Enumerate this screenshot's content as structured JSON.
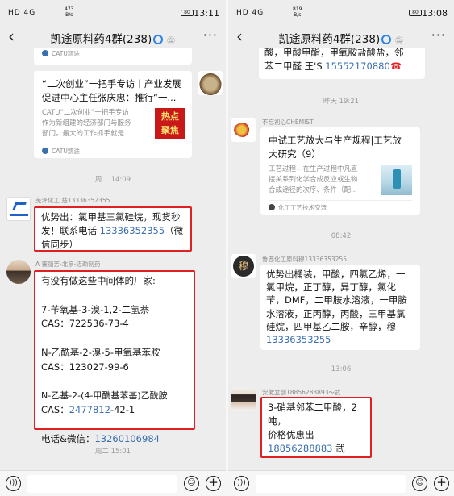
{
  "left": {
    "status": {
      "signal": "HD 4G",
      "speed": "473\nB/s",
      "battery": "80",
      "time": "13:11"
    },
    "header": {
      "title": "凯途原料药4群(238)"
    },
    "card_top_footer": "CATU凯途",
    "article_card": {
      "title_lines": [
        "“二次创业”一把手专访丨产业发展",
        "促进中心主任张庆忠：推行“一..."
      ],
      "desc_lines": [
        "CATU“二次创业”一把手专访",
        "作为新组建的经济部门与服务",
        "部门，最大的工作抓手就是..."
      ],
      "thumb_text": [
        "热点",
        "聚焦"
      ],
      "footer": "CATU凯途"
    },
    "ts1": "周二 14:09",
    "msg1": {
      "sender": "芜泽化工 楚13336352355",
      "lines": [
        "优势出：氯甲基三氯硅烷，现货秒",
        "发！联系电话 ",
        "信同步）"
      ],
      "phone": "13336352355",
      "after_phone": "（微"
    },
    "msg2": {
      "sender": "A 董丽芳-北京-迈劲制药",
      "lines": [
        "有没有做这些中间体的厂家:",
        "",
        "7-苄氧基-3-溴-1,2-二氢萘",
        "CAS：722536-73-4",
        "",
        "N-乙酰基-2-溴-5-甲氧基苯胺",
        "CAS：123027-99-6",
        "",
        "N-乙基-2-(4-甲酰基苯基)乙酰胺",
        "CAS："
      ],
      "cas_link": "2477812",
      "cas_rest": "-42-1",
      "contact_label": "电话&微信：",
      "contact_phone": "13260106984"
    },
    "ts2": "周二 15:01"
  },
  "right": {
    "status": {
      "signal": "HD 4G",
      "speed": "819\nB/s",
      "battery": "80",
      "time": "13:08"
    },
    "header": {
      "title": "凯途原料药4群(238)"
    },
    "top_bubble": {
      "lines": [
        "酸，甲酸甲酯，甲氧胺盐酸盐，邻",
        "苯二甲醛   王'S "
      ],
      "phone": "15552170880"
    },
    "ts1": "昨天 19:21",
    "card_msg": {
      "sender": "不忘初心CHEMIST",
      "title_lines": [
        "中试工艺放大与生产规程|工艺放",
        "大研究（9）"
      ],
      "desc_lines": [
        "工艺过程—在生产过程中凡直",
        "接关系到化学合成反应或生物",
        "合成途径的次序、条件（配..."
      ],
      "footer": "化工工艺技术交流"
    },
    "ts2": "08:42",
    "msg_lu": {
      "sender": "鲁西化工原料穆13336353255",
      "avatar_char": "穆",
      "lines": [
        "优势出桶装，甲酸，四氯乙烯，一",
        "氯甲烷，正丁醇，异丁醇，氯化",
        "苄，DMF，二甲胺水溶液，一甲胺",
        "水溶液，正丙醇，丙酸，三甲基氯",
        "硅烷，四甲基乙二胺，辛醇，穆"
      ],
      "phone": "13336353255"
    },
    "ts3": "13:06",
    "msg_wu": {
      "sender": "安徽立创18856288893～武",
      "lines": [
        "3-硝基邻苯二甲酸，2",
        "吨，",
        "价格优惠出"
      ],
      "phone": "18856288883",
      "suffix": " 武"
    }
  },
  "colors": {
    "highlight": "#e02020",
    "link": "#3a6fb0",
    "chat_bg": "#ededed"
  }
}
